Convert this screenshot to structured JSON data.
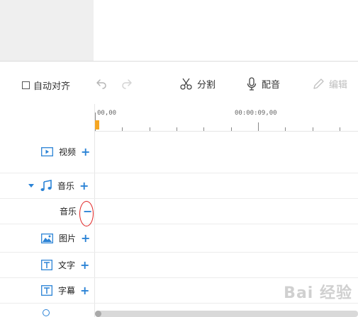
{
  "toolbar": {
    "auto_align_label": "自动对齐",
    "split_label": "分割",
    "dub_label": "配音",
    "edit_label": "编辑"
  },
  "ruler": {
    "start_time": "00,00",
    "mid_time": "00:00:09,00"
  },
  "tracks": [
    {
      "label": "视频",
      "icon": "video-icon",
      "action": "+"
    },
    {
      "label": "音乐",
      "icon": "music-note-icon",
      "action": "+",
      "expanded": true
    },
    {
      "label": "音乐",
      "action": "−"
    },
    {
      "label": "图片",
      "icon": "image-icon",
      "action": "+"
    },
    {
      "label": "文字",
      "icon": "text-icon",
      "action": "+"
    },
    {
      "label": "字幕",
      "icon": "subtitle-icon",
      "action": "+"
    }
  ],
  "colors": {
    "accent": "#2b83d6",
    "playhead": "#f5a623",
    "highlight": "#e02020"
  },
  "watermark": "Bai 经验"
}
